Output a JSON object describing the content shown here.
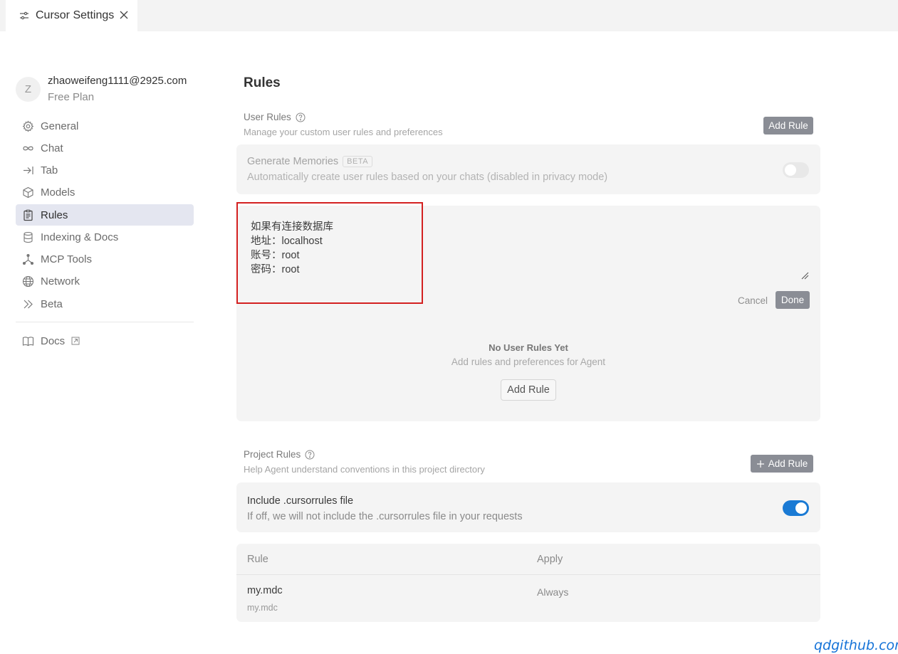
{
  "tab": {
    "title": "Cursor Settings"
  },
  "account": {
    "avatar_letter": "Z",
    "email": "zhaoweifeng1111@2925.com",
    "plan": "Free Plan"
  },
  "sidebar": {
    "items": [
      {
        "label": "General",
        "icon": "gear-icon"
      },
      {
        "label": "Chat",
        "icon": "infinity-icon"
      },
      {
        "label": "Tab",
        "icon": "arrow-right-bar-icon"
      },
      {
        "label": "Models",
        "icon": "cube-icon"
      },
      {
        "label": "Rules",
        "icon": "clipboard-icon",
        "active": true
      },
      {
        "label": "Indexing & Docs",
        "icon": "database-icon"
      },
      {
        "label": "MCP Tools",
        "icon": "nodes-icon"
      },
      {
        "label": "Network",
        "icon": "globe-icon"
      },
      {
        "label": "Beta",
        "icon": "double-chevron-icon"
      }
    ],
    "docs_label": "Docs"
  },
  "main": {
    "title": "Rules",
    "user_rules": {
      "title": "User Rules",
      "description": "Manage your custom user rules and preferences",
      "add_button": "Add Rule"
    },
    "memories": {
      "title": "Generate Memories",
      "badge": "BETA",
      "description": "Automatically create user rules based on your chats (disabled in privacy mode)",
      "enabled": false
    },
    "editor": {
      "text": "如果有连接数据库\n地址：localhost\n账号：root\n密码：root",
      "cancel_label": "Cancel",
      "done_label": "Done"
    },
    "empty_state": {
      "title": "No User Rules Yet",
      "description": "Add rules and preferences for Agent",
      "button": "Add Rule"
    },
    "project_rules": {
      "title": "Project Rules",
      "description": "Help Agent understand conventions in this project directory",
      "add_button": "Add Rule"
    },
    "include_cursorrules": {
      "title": "Include .cursorrules file",
      "description": "If off, we will not include the .cursorrules file in your requests",
      "enabled": true
    },
    "rules_table": {
      "columns": [
        "Rule",
        "Apply"
      ],
      "rows": [
        {
          "name": "my.mdc",
          "path": "my.mdc",
          "apply": "Always"
        }
      ]
    }
  },
  "watermark": "qdgithub.com",
  "colors": {
    "toggle_on": "#1a7ad4",
    "highlight": "#d32020",
    "active_nav": "#e4e6f0"
  }
}
